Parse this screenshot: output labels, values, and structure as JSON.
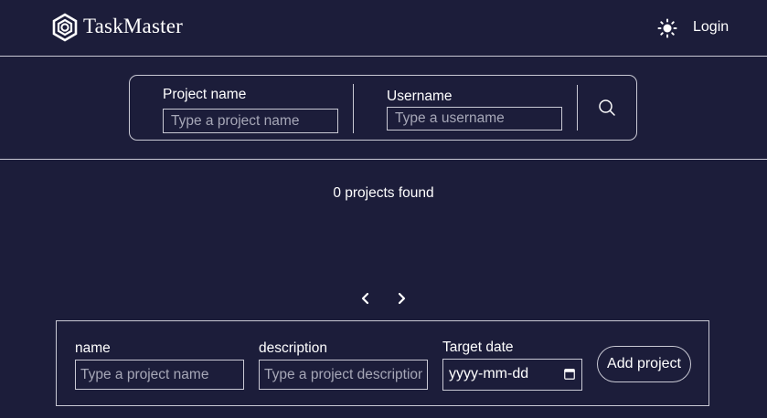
{
  "header": {
    "brand": "TaskMaster",
    "logo_icon": "hexagon-logo-icon",
    "theme_icon": "sun-icon",
    "login_label": "Login"
  },
  "search": {
    "project_label": "Project name",
    "project_placeholder": "Type a project name",
    "project_value": "",
    "username_label": "Username",
    "username_placeholder": "Type a username",
    "username_value": "",
    "search_icon": "search-icon"
  },
  "results": {
    "count_text": "0 projects found"
  },
  "pagination": {
    "prev_icon": "chevron-left-icon",
    "next_icon": "chevron-right-icon"
  },
  "add_project": {
    "name_label": "name",
    "name_placeholder": "Type a project name",
    "description_label": "description",
    "description_placeholder": "Type a project description",
    "date_label": "Target date",
    "date_placeholder": "yyyy-mm-dd",
    "calendar_icon": "calendar-icon",
    "submit_label": "Add project"
  },
  "colors": {
    "background": "#1c1d3a",
    "border": "#c9c9d4",
    "text": "#ffffff",
    "placeholder": "#a6a7b7"
  }
}
